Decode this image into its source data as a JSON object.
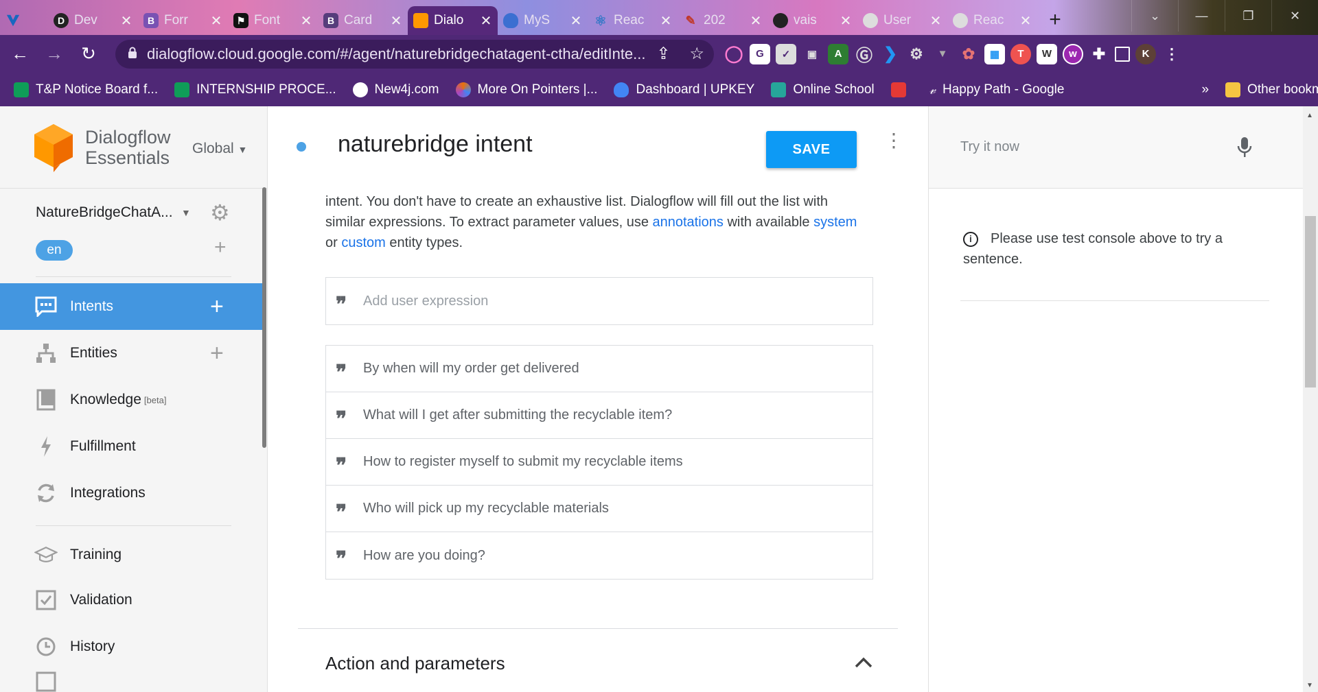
{
  "browser": {
    "tabs": [
      {
        "label": "",
        "icon": "vuetify-icon",
        "color": "#1867c0"
      },
      {
        "label": "Dev",
        "icon": "dev-icon",
        "color": "#222222"
      },
      {
        "label": "Forr",
        "icon": "bootstrap-icon",
        "color": "#7952b3"
      },
      {
        "label": "Font",
        "icon": "flag-icon",
        "color": "#111111"
      },
      {
        "label": "Card",
        "icon": "bootstrap-icon",
        "color": "#563d7c"
      },
      {
        "label": "Dialo",
        "icon": "dialogflow-icon",
        "color": "#ff9800",
        "active": true
      },
      {
        "label": "MyS",
        "icon": "shield-icon",
        "color": "#3b6fd1"
      },
      {
        "label": "Reac",
        "icon": "react-icon",
        "color": "#3a78c8"
      },
      {
        "label": "202",
        "icon": "pen-icon",
        "color": "#c0392b"
      },
      {
        "label": "vais",
        "icon": "github-icon",
        "color": "#222222"
      },
      {
        "label": "User",
        "icon": "puzzle-icon",
        "color": "#dddddd"
      },
      {
        "label": "Reac",
        "icon": "globe-icon",
        "color": "#dddddd"
      }
    ],
    "new_tab": "+",
    "url": "dialogflow.cloud.google.com/#/agent/naturebridgechatagent-ctha/editInte...",
    "bookmarks": [
      {
        "label": "T&P Notice Board f...",
        "color": "#0f9d58"
      },
      {
        "label": "INTERNSHIP PROCE...",
        "color": "#0f9d58"
      },
      {
        "label": "New4j.com",
        "color": "#ffffff"
      },
      {
        "label": "More On Pointers |...",
        "color": "#e8710a"
      },
      {
        "label": "Dashboard | UPKEY",
        "color": "#4285f4"
      },
      {
        "label": "Online School",
        "color": "#26a69a"
      },
      {
        "label": "",
        "color": "#e53935"
      },
      {
        "label": "Happy Path - Google",
        "color": "#ffffff"
      }
    ],
    "bookmarks_more": "»",
    "other_bookmarks": "Other bookmarks",
    "profile_initial": "K"
  },
  "sidebar": {
    "brand_line1": "Dialogflow",
    "brand_line2": "Essentials",
    "region": "Global",
    "agent_name": "NatureBridgeChatA...",
    "language": "en",
    "menu": [
      {
        "label": "Intents",
        "icon": "intents-icon",
        "active": true,
        "add": true
      },
      {
        "label": "Entities",
        "icon": "entities-icon",
        "add": true
      },
      {
        "label": "Knowledge",
        "badge": "[beta]",
        "icon": "knowledge-icon"
      },
      {
        "label": "Fulfillment",
        "icon": "fulfillment-icon"
      },
      {
        "label": "Integrations",
        "icon": "integrations-icon"
      },
      {
        "label": "Training",
        "icon": "training-icon"
      },
      {
        "label": "Validation",
        "icon": "validation-icon"
      },
      {
        "label": "History",
        "icon": "history-icon"
      }
    ]
  },
  "main": {
    "title": "naturebridge intent",
    "save_label": "SAVE",
    "desc_part1": "intent. You don't have to create an exhaustive list. Dialogflow will fill out the list with similar expressions. To extract parameter values, use ",
    "desc_link1": "annotations",
    "desc_part2": " with available ",
    "desc_link2": "system",
    "desc_part3": " or ",
    "desc_link3": "custom",
    "desc_part4": " entity types.",
    "add_expression_placeholder": "Add user expression",
    "expressions": [
      "By when will my order get delivered",
      "What will I get after submitting the recyclable item?",
      "How to register myself to submit my recyclable items",
      "Who will pick up my recyclable materials",
      "How are you doing?"
    ],
    "section_title": "Action and parameters"
  },
  "test_panel": {
    "placeholder": "Try it now",
    "info_message": "Please use test console above to try a sentence."
  },
  "colors": {
    "accent": "#0d9af5",
    "active_menu": "#4396e0",
    "browser_frame": "#4f2876"
  }
}
